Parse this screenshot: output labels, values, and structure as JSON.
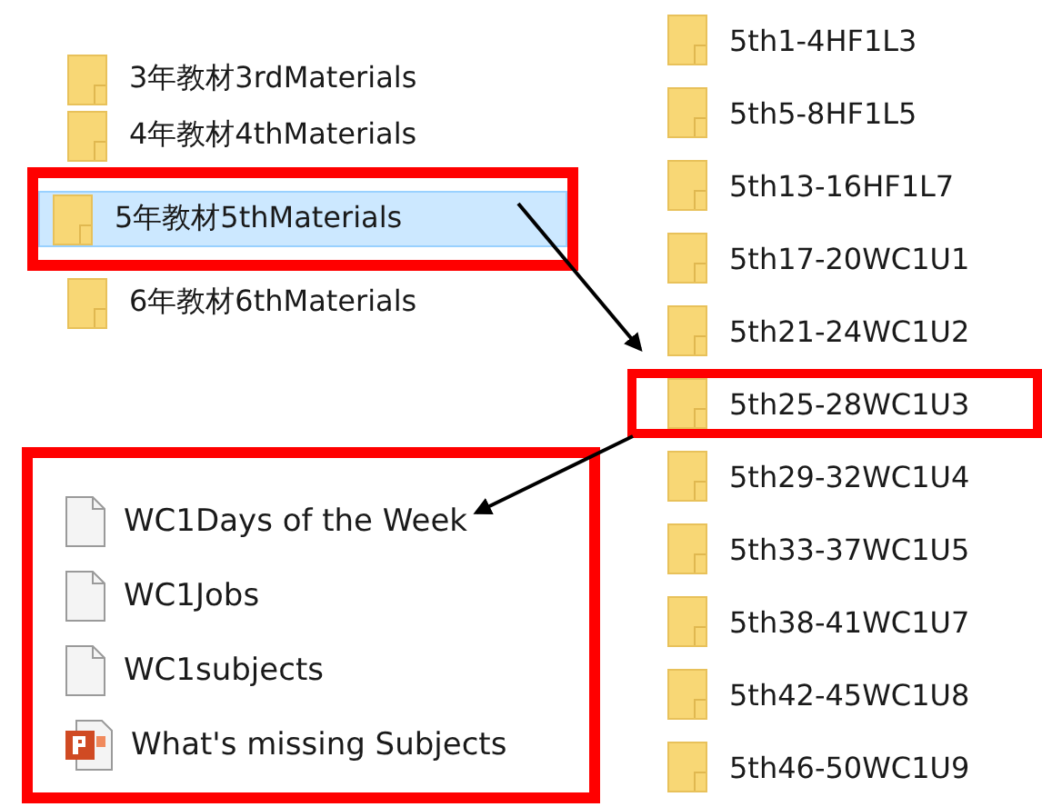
{
  "folder_tree": [
    {
      "label": "3年教材3rdMaterials",
      "selected": false,
      "marked": false
    },
    {
      "label": "4年教材4thMaterials",
      "selected": false,
      "marked": false
    },
    {
      "label": "5年教材5thMaterials",
      "selected": true,
      "marked": true
    },
    {
      "label": "6年教材6thMaterials",
      "selected": false,
      "marked": false
    }
  ],
  "subfolders": [
    {
      "label": "5th1-4HF1L3",
      "marked": false
    },
    {
      "label": "5th5-8HF1L5",
      "marked": false
    },
    {
      "label": "5th13-16HF1L7",
      "marked": false
    },
    {
      "label": "5th17-20WC1U1",
      "marked": false
    },
    {
      "label": "5th21-24WC1U2",
      "marked": false
    },
    {
      "label": "5th25-28WC1U3",
      "marked": true
    },
    {
      "label": "5th29-32WC1U4",
      "marked": false
    },
    {
      "label": "5th33-37WC1U5",
      "marked": false
    },
    {
      "label": "5th38-41WC1U7",
      "marked": false
    },
    {
      "label": "5th42-45WC1U8",
      "marked": false
    },
    {
      "label": "5th46-50WC1U9",
      "marked": false
    }
  ],
  "files": [
    {
      "name": "WC1Days of the Week",
      "kind": "document"
    },
    {
      "name": "WC1Jobs",
      "kind": "document"
    },
    {
      "name": "WC1subjects",
      "kind": "document"
    },
    {
      "name": "What's missing Subjects",
      "kind": "presentation"
    }
  ]
}
